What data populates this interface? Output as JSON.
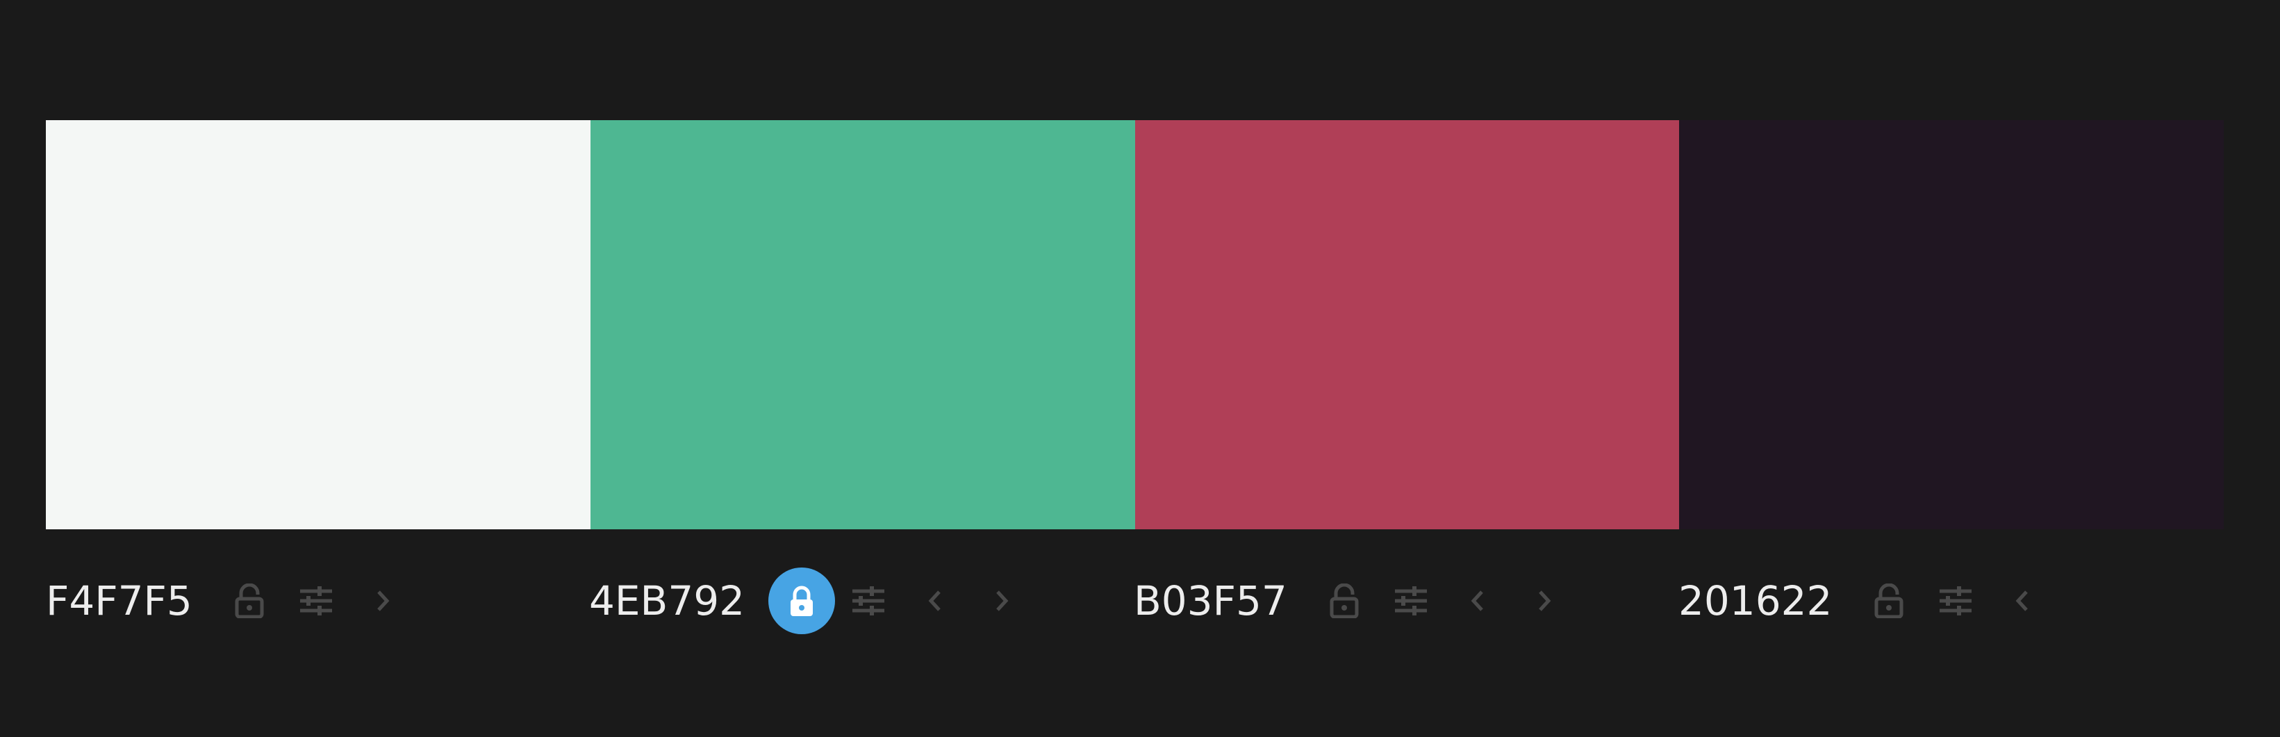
{
  "colors": [
    {
      "hex_label": "F4F7F5",
      "value": "#F4F7F5",
      "locked": false,
      "controls": [
        "lock-icon",
        "adjust-icon",
        "chevron-right-icon"
      ]
    },
    {
      "hex_label": "4EB792",
      "value": "#4EB792",
      "locked": true,
      "controls": [
        "lock-icon",
        "adjust-icon",
        "chevron-left-icon",
        "chevron-right-icon"
      ]
    },
    {
      "hex_label": "B03F57",
      "value": "#B03F57",
      "locked": false,
      "controls": [
        "lock-icon",
        "adjust-icon",
        "chevron-left-icon",
        "chevron-right-icon"
      ]
    },
    {
      "hex_label": "201622",
      "value": "#201622",
      "locked": false,
      "controls": [
        "lock-icon",
        "adjust-icon",
        "chevron-left-icon"
      ]
    }
  ],
  "theme": {
    "background": "#1A1A1A",
    "label_color": "#EDEDED",
    "icon_color": "#4A4A4A",
    "lock_active_bg": "#47A4E4"
  }
}
